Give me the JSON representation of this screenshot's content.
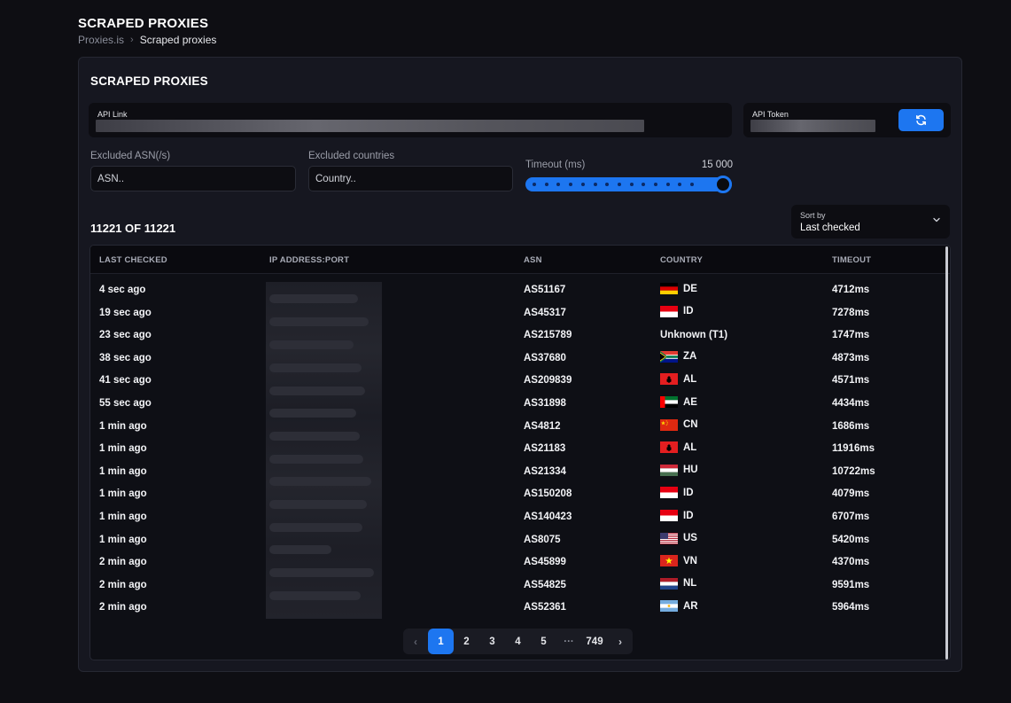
{
  "header": {
    "title": "SCRAPED PROXIES",
    "breadcrumb_root": "Proxies.is",
    "breadcrumb_sep": "›",
    "breadcrumb_current": "Scraped proxies"
  },
  "card": {
    "title": "SCRAPED PROXIES",
    "api_link_label": "API Link",
    "api_token_label": "API Token",
    "refresh_icon": "refresh-icon"
  },
  "filters": {
    "asn_label": "Excluded ASN(/s)",
    "asn_placeholder": "ASN..",
    "countries_label": "Excluded countries",
    "countries_placeholder": "Country..",
    "timeout_label": "Timeout (ms)",
    "timeout_value": "15 000",
    "timeout_fraction": 1.0
  },
  "results": {
    "count_text": "11221 OF 11221",
    "sort_label": "Sort by",
    "sort_value": "Last checked"
  },
  "table": {
    "headers": {
      "last_checked": "LAST CHECKED",
      "ip": "IP ADDRESS:PORT",
      "asn": "ASN",
      "country": "COUNTRY",
      "timeout": "TIMEOUT"
    },
    "rows": [
      {
        "last": "4 sec ago",
        "asn": "AS51167",
        "flag": "de",
        "country": "DE",
        "timeout": "4712ms"
      },
      {
        "last": "19 sec ago",
        "asn": "AS45317",
        "flag": "id",
        "country": "ID",
        "timeout": "7278ms"
      },
      {
        "last": "23 sec ago",
        "asn": "AS215789",
        "flag": "",
        "country": "Unknown (T1)",
        "timeout": "1747ms"
      },
      {
        "last": "38 sec ago",
        "asn": "AS37680",
        "flag": "za",
        "country": "ZA",
        "timeout": "4873ms"
      },
      {
        "last": "41 sec ago",
        "asn": "AS209839",
        "flag": "al",
        "country": "AL",
        "timeout": "4571ms"
      },
      {
        "last": "55 sec ago",
        "asn": "AS31898",
        "flag": "ae",
        "country": "AE",
        "timeout": "4434ms"
      },
      {
        "last": "1 min ago",
        "asn": "AS4812",
        "flag": "cn",
        "country": "CN",
        "timeout": "1686ms"
      },
      {
        "last": "1 min ago",
        "asn": "AS21183",
        "flag": "al",
        "country": "AL",
        "timeout": "11916ms"
      },
      {
        "last": "1 min ago",
        "asn": "AS21334",
        "flag": "hu",
        "country": "HU",
        "timeout": "10722ms"
      },
      {
        "last": "1 min ago",
        "asn": "AS150208",
        "flag": "id",
        "country": "ID",
        "timeout": "4079ms"
      },
      {
        "last": "1 min ago",
        "asn": "AS140423",
        "flag": "id",
        "country": "ID",
        "timeout": "6707ms"
      },
      {
        "last": "1 min ago",
        "asn": "AS8075",
        "flag": "us",
        "country": "US",
        "timeout": "5420ms"
      },
      {
        "last": "2 min ago",
        "asn": "AS45899",
        "flag": "vn",
        "country": "VN",
        "timeout": "4370ms"
      },
      {
        "last": "2 min ago",
        "asn": "AS54825",
        "flag": "nl",
        "country": "NL",
        "timeout": "9591ms"
      },
      {
        "last": "2 min ago",
        "asn": "AS52361",
        "flag": "ar",
        "country": "AR",
        "timeout": "5964ms"
      }
    ]
  },
  "pagination": {
    "prev": "‹",
    "pages": [
      "1",
      "2",
      "3",
      "4",
      "5"
    ],
    "ellipsis": "···",
    "last": "749",
    "next": "›",
    "current": "1"
  },
  "colors": {
    "accent": "#1d76f0",
    "background": "#0e0e13",
    "card": "#161720"
  }
}
